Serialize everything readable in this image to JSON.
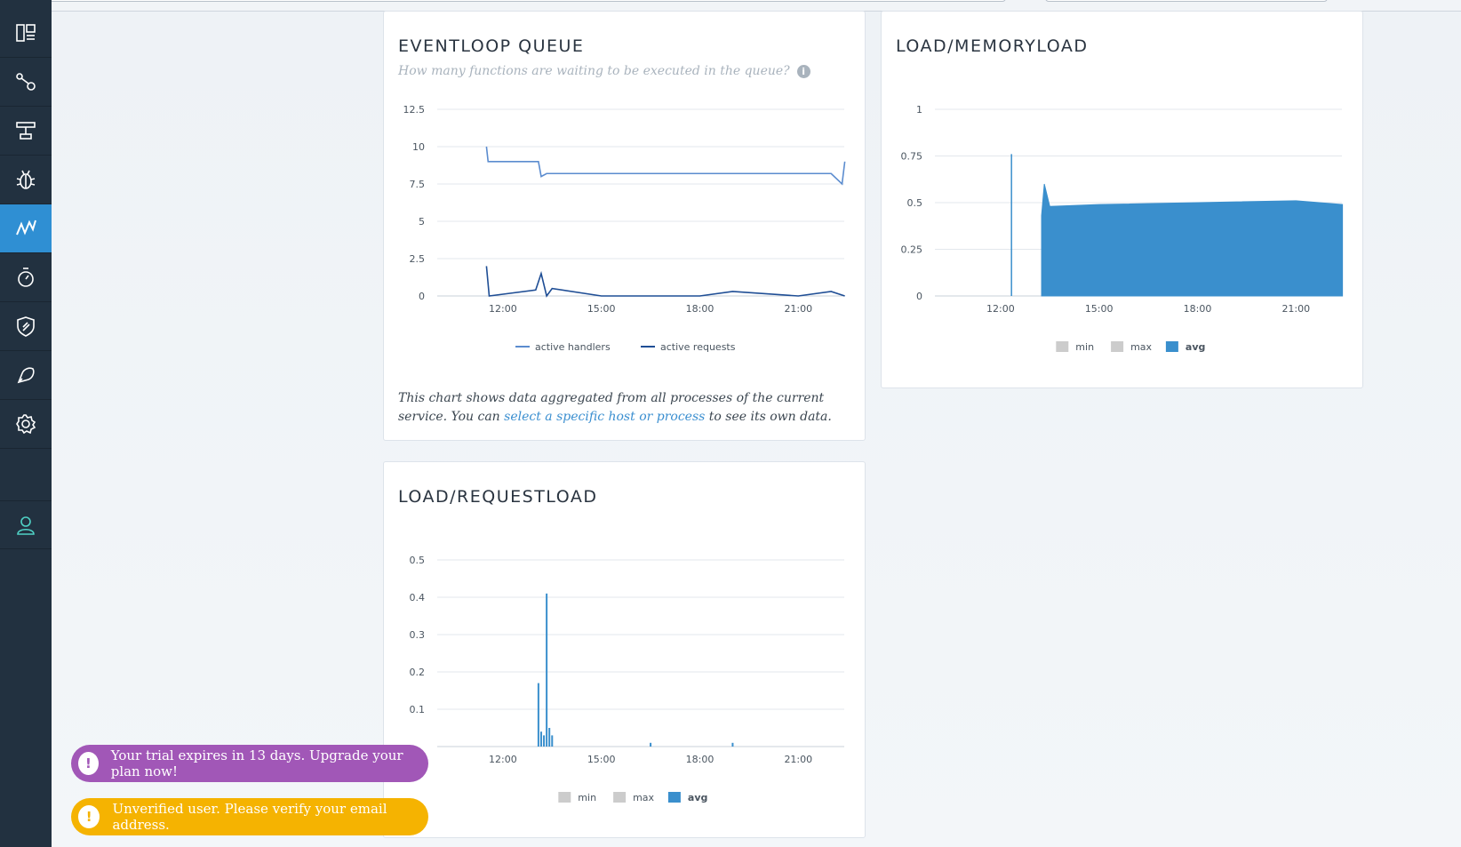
{
  "sidebar": {
    "items": [
      {
        "icon": "dashboard-icon",
        "active": false
      },
      {
        "icon": "topology-icon",
        "active": false
      },
      {
        "icon": "filter-icon",
        "active": false
      },
      {
        "icon": "bug-icon",
        "active": false
      },
      {
        "icon": "metrics-icon",
        "active": true
      },
      {
        "icon": "stopwatch-icon",
        "active": false
      },
      {
        "icon": "shield-icon",
        "active": false
      },
      {
        "icon": "alert-icon",
        "active": false
      },
      {
        "icon": "gear-icon",
        "active": false
      },
      {
        "icon": "user-icon",
        "active": false
      }
    ]
  },
  "cards": {
    "eventloop": {
      "title": "EVENTLOOP QUEUE",
      "subtitle": "How many functions are waiting to be executed in the queue?",
      "note_prefix": "This chart shows data aggregated from all processes of the current service. You can ",
      "note_link": "select a specific host or process",
      "note_suffix": " to see its own data."
    },
    "memoryload": {
      "title": "LOAD/MEMORYLOAD"
    },
    "requestload": {
      "title": "LOAD/REQUESTLOAD"
    }
  },
  "toasts": {
    "trial": "Your trial expires in 13 days. Upgrade your plan now!",
    "unverified": "Unverified user. Please verify your email address.",
    "icon": "!"
  },
  "colors": {
    "accent": "#2f8fd3",
    "sidebar": "#223140",
    "handlers": "#5b8ccf",
    "requests": "#1f4e95",
    "bar": "#3a8fcd",
    "legend_disabled": "#cccccc",
    "toast_trial": "#a157b7",
    "toast_unverified": "#f5b301"
  },
  "chart_data": [
    {
      "type": "line",
      "x_ticks": [
        "12:00",
        "15:00",
        "18:00",
        "21:00"
      ],
      "ylim": [
        0,
        12.5
      ],
      "y_ticks": [
        "0",
        "2.5",
        "5",
        "7.5",
        "10",
        "12.5"
      ],
      "series": [
        {
          "name": "active handlers",
          "x": [
            "11:30",
            "11:33",
            "13:05",
            "13:10",
            "13:20",
            "13:30",
            "14:00",
            "15:00",
            "16:00",
            "17:00",
            "18:00",
            "19:00",
            "20:00",
            "21:00",
            "22:00",
            "22:20",
            "22:25"
          ],
          "values": [
            10,
            9,
            9,
            8,
            8.2,
            8.2,
            8.2,
            8.2,
            8.2,
            8.2,
            8.2,
            8.2,
            8.2,
            8.2,
            8.2,
            7.5,
            9
          ]
        },
        {
          "name": "active requests",
          "x": [
            "11:30",
            "11:35",
            "13:00",
            "13:10",
            "13:20",
            "13:30",
            "15:00",
            "18:00",
            "19:00",
            "21:00",
            "22:00",
            "22:25"
          ],
          "values": [
            2,
            0,
            0.4,
            1.5,
            0,
            0.5,
            0,
            0,
            0.3,
            0,
            0.3,
            0
          ]
        }
      ],
      "grid": true,
      "legend_position": "bottom"
    },
    {
      "type": "area",
      "x_ticks": [
        "12:00",
        "15:00",
        "18:00",
        "21:00"
      ],
      "ylim": [
        0,
        1
      ],
      "y_ticks": [
        "0",
        "0.25",
        "0.5",
        "0.75",
        "1"
      ],
      "series": [
        {
          "name": "min",
          "values": []
        },
        {
          "name": "max",
          "values": []
        },
        {
          "name": "avg",
          "x": [
            "12:20",
            "13:15",
            "13:20",
            "13:30",
            "15:00",
            "18:00",
            "21:00",
            "22:25"
          ],
          "values": [
            0.76,
            0.43,
            0.6,
            0.48,
            0.49,
            0.5,
            0.51,
            0.49
          ]
        }
      ],
      "grid": true,
      "legend_position": "bottom"
    },
    {
      "type": "bar",
      "x_ticks": [
        "12:00",
        "15:00",
        "18:00",
        "21:00"
      ],
      "ylim": [
        0,
        0.5
      ],
      "y_ticks": [
        "0.1",
        "0.2",
        "0.3",
        "0.4",
        "0.5"
      ],
      "series": [
        {
          "name": "min",
          "values": []
        },
        {
          "name": "max",
          "values": []
        },
        {
          "name": "avg",
          "x": [
            "13:05",
            "13:10",
            "13:15",
            "13:20",
            "13:25",
            "13:30",
            "16:30",
            "19:00"
          ],
          "values": [
            0.17,
            0.04,
            0.03,
            0.41,
            0.05,
            0.03,
            0.01,
            0.01
          ]
        }
      ],
      "grid": true,
      "legend_position": "bottom"
    }
  ]
}
